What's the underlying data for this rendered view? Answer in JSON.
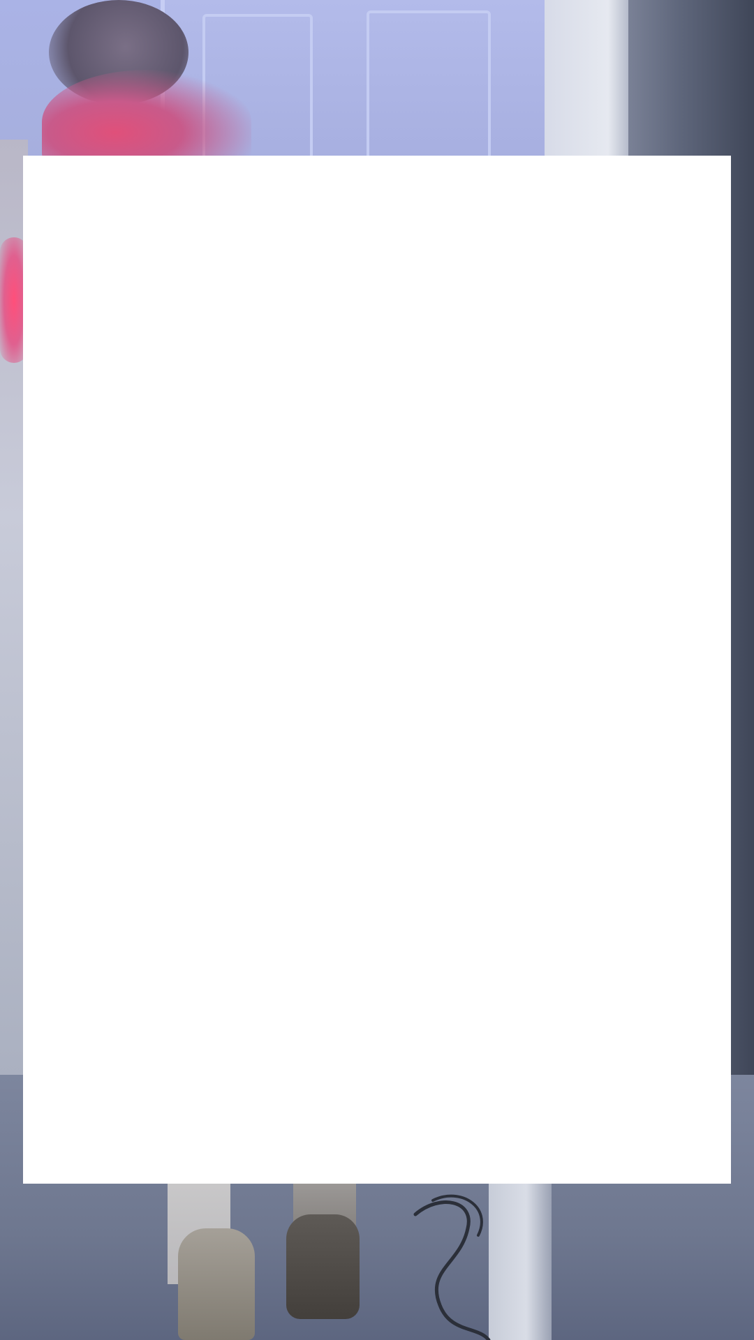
{
  "colors": {
    "overlay_panel": "#ffffff",
    "wall": "#a4acd8",
    "floor": "#6e778f",
    "hair_pink": "#e0507a"
  },
  "background": {
    "type": "photo",
    "subject": "mirror selfie"
  },
  "overlay_panel": {
    "visible": true,
    "content": ""
  }
}
